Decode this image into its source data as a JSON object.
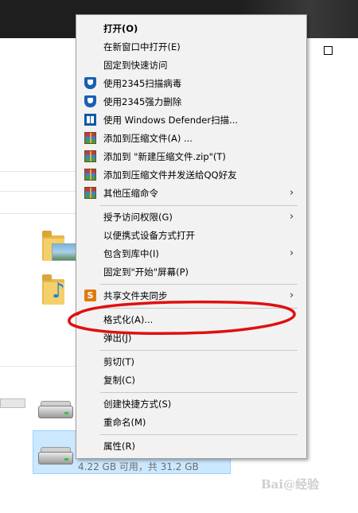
{
  "context_menu": {
    "items": [
      {
        "label": "打开(O)",
        "bold": true
      },
      {
        "label": "在新窗口中打开(E)"
      },
      {
        "label": "固定到快速访问"
      },
      {
        "label": "使用2345扫描病毒",
        "icon": "shield-icon"
      },
      {
        "label": "使用2345强力删除",
        "icon": "shield-icon"
      },
      {
        "label": "使用 Windows Defender扫描...",
        "icon": "windows-defender-icon"
      },
      {
        "label": "添加到压缩文件(A) ...",
        "icon": "archive-icon"
      },
      {
        "label": "添加到 \"新建压缩文件.zip\"(T)",
        "icon": "archive-icon"
      },
      {
        "label": "添加到压缩文件并发送给QQ好友",
        "icon": "archive-icon"
      },
      {
        "label": "其他压缩命令",
        "icon": "archive-icon",
        "submenu": true
      },
      {
        "label": "授予访问权限(G)",
        "submenu": true
      },
      {
        "label": "以便携式设备方式打开"
      },
      {
        "label": "包含到库中(I)",
        "submenu": true
      },
      {
        "label": "固定到\"开始\"屏幕(P)"
      },
      {
        "label": "共享文件夹同步",
        "icon": "sync-icon",
        "submenu": true
      },
      {
        "label": "格式化(A)..."
      },
      {
        "label": "弹出(J)"
      },
      {
        "label": "剪切(T)"
      },
      {
        "label": "复制(C)"
      },
      {
        "label": "创建快捷方式(S)"
      },
      {
        "label": "重命名(M)"
      },
      {
        "label": "属性(R)"
      }
    ],
    "submenu_arrow": "›"
  },
  "background": {
    "selected_drive_info": "4.22 GB 可用，共 31.2 GB",
    "music_note": "♪"
  },
  "watermark": "Bai@经验",
  "colors": {
    "menu_bg": "#f2f2f2",
    "selection": "#cce8ff",
    "annotation": "#e01010"
  }
}
